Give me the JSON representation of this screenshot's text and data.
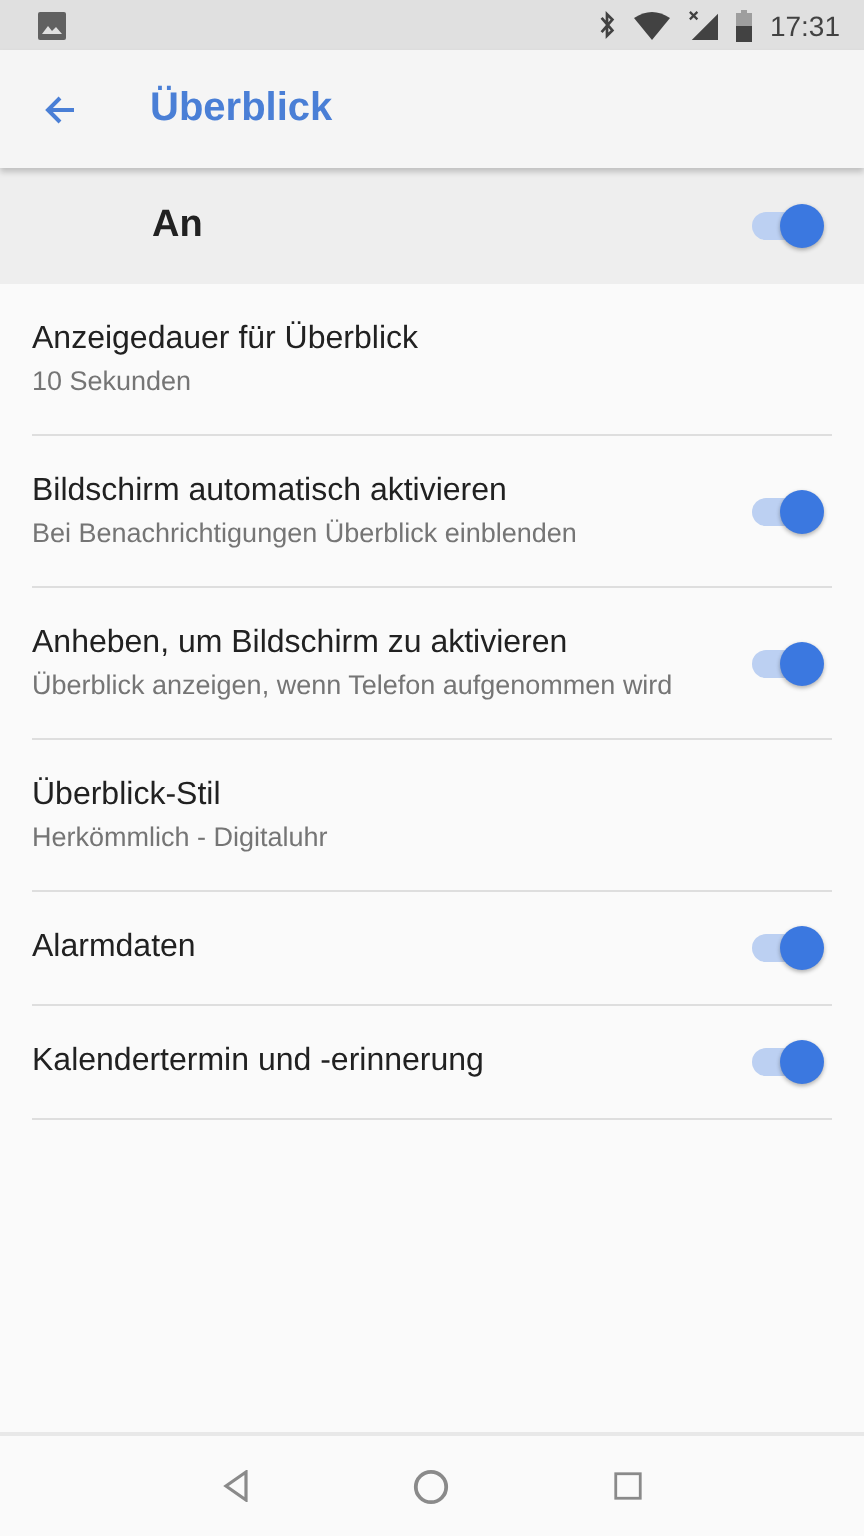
{
  "status_bar": {
    "time": "17:31"
  },
  "app_bar": {
    "title": "Überblick"
  },
  "master_switch": {
    "label": "An",
    "on": true
  },
  "settings": [
    {
      "kind": "text",
      "title": "Anzeigedauer für Überblick",
      "summary": "10 Sekunden"
    },
    {
      "kind": "switch",
      "title": "Bildschirm automatisch aktivieren",
      "summary": "Bei Benachrichtigungen Überblick einblenden",
      "on": true
    },
    {
      "kind": "switch",
      "title": "Anheben, um Bildschirm zu aktivieren",
      "summary": "Überblick anzeigen, wenn Telefon aufgenommen wird",
      "on": true
    },
    {
      "kind": "text",
      "title": "Überblick-Stil",
      "summary": "Herkömmlich - Digitaluhr"
    },
    {
      "kind": "switch",
      "title": "Alarmdaten",
      "on": true
    },
    {
      "kind": "switch",
      "title": "Kalendertermin und -erinnerung",
      "on": true
    }
  ]
}
